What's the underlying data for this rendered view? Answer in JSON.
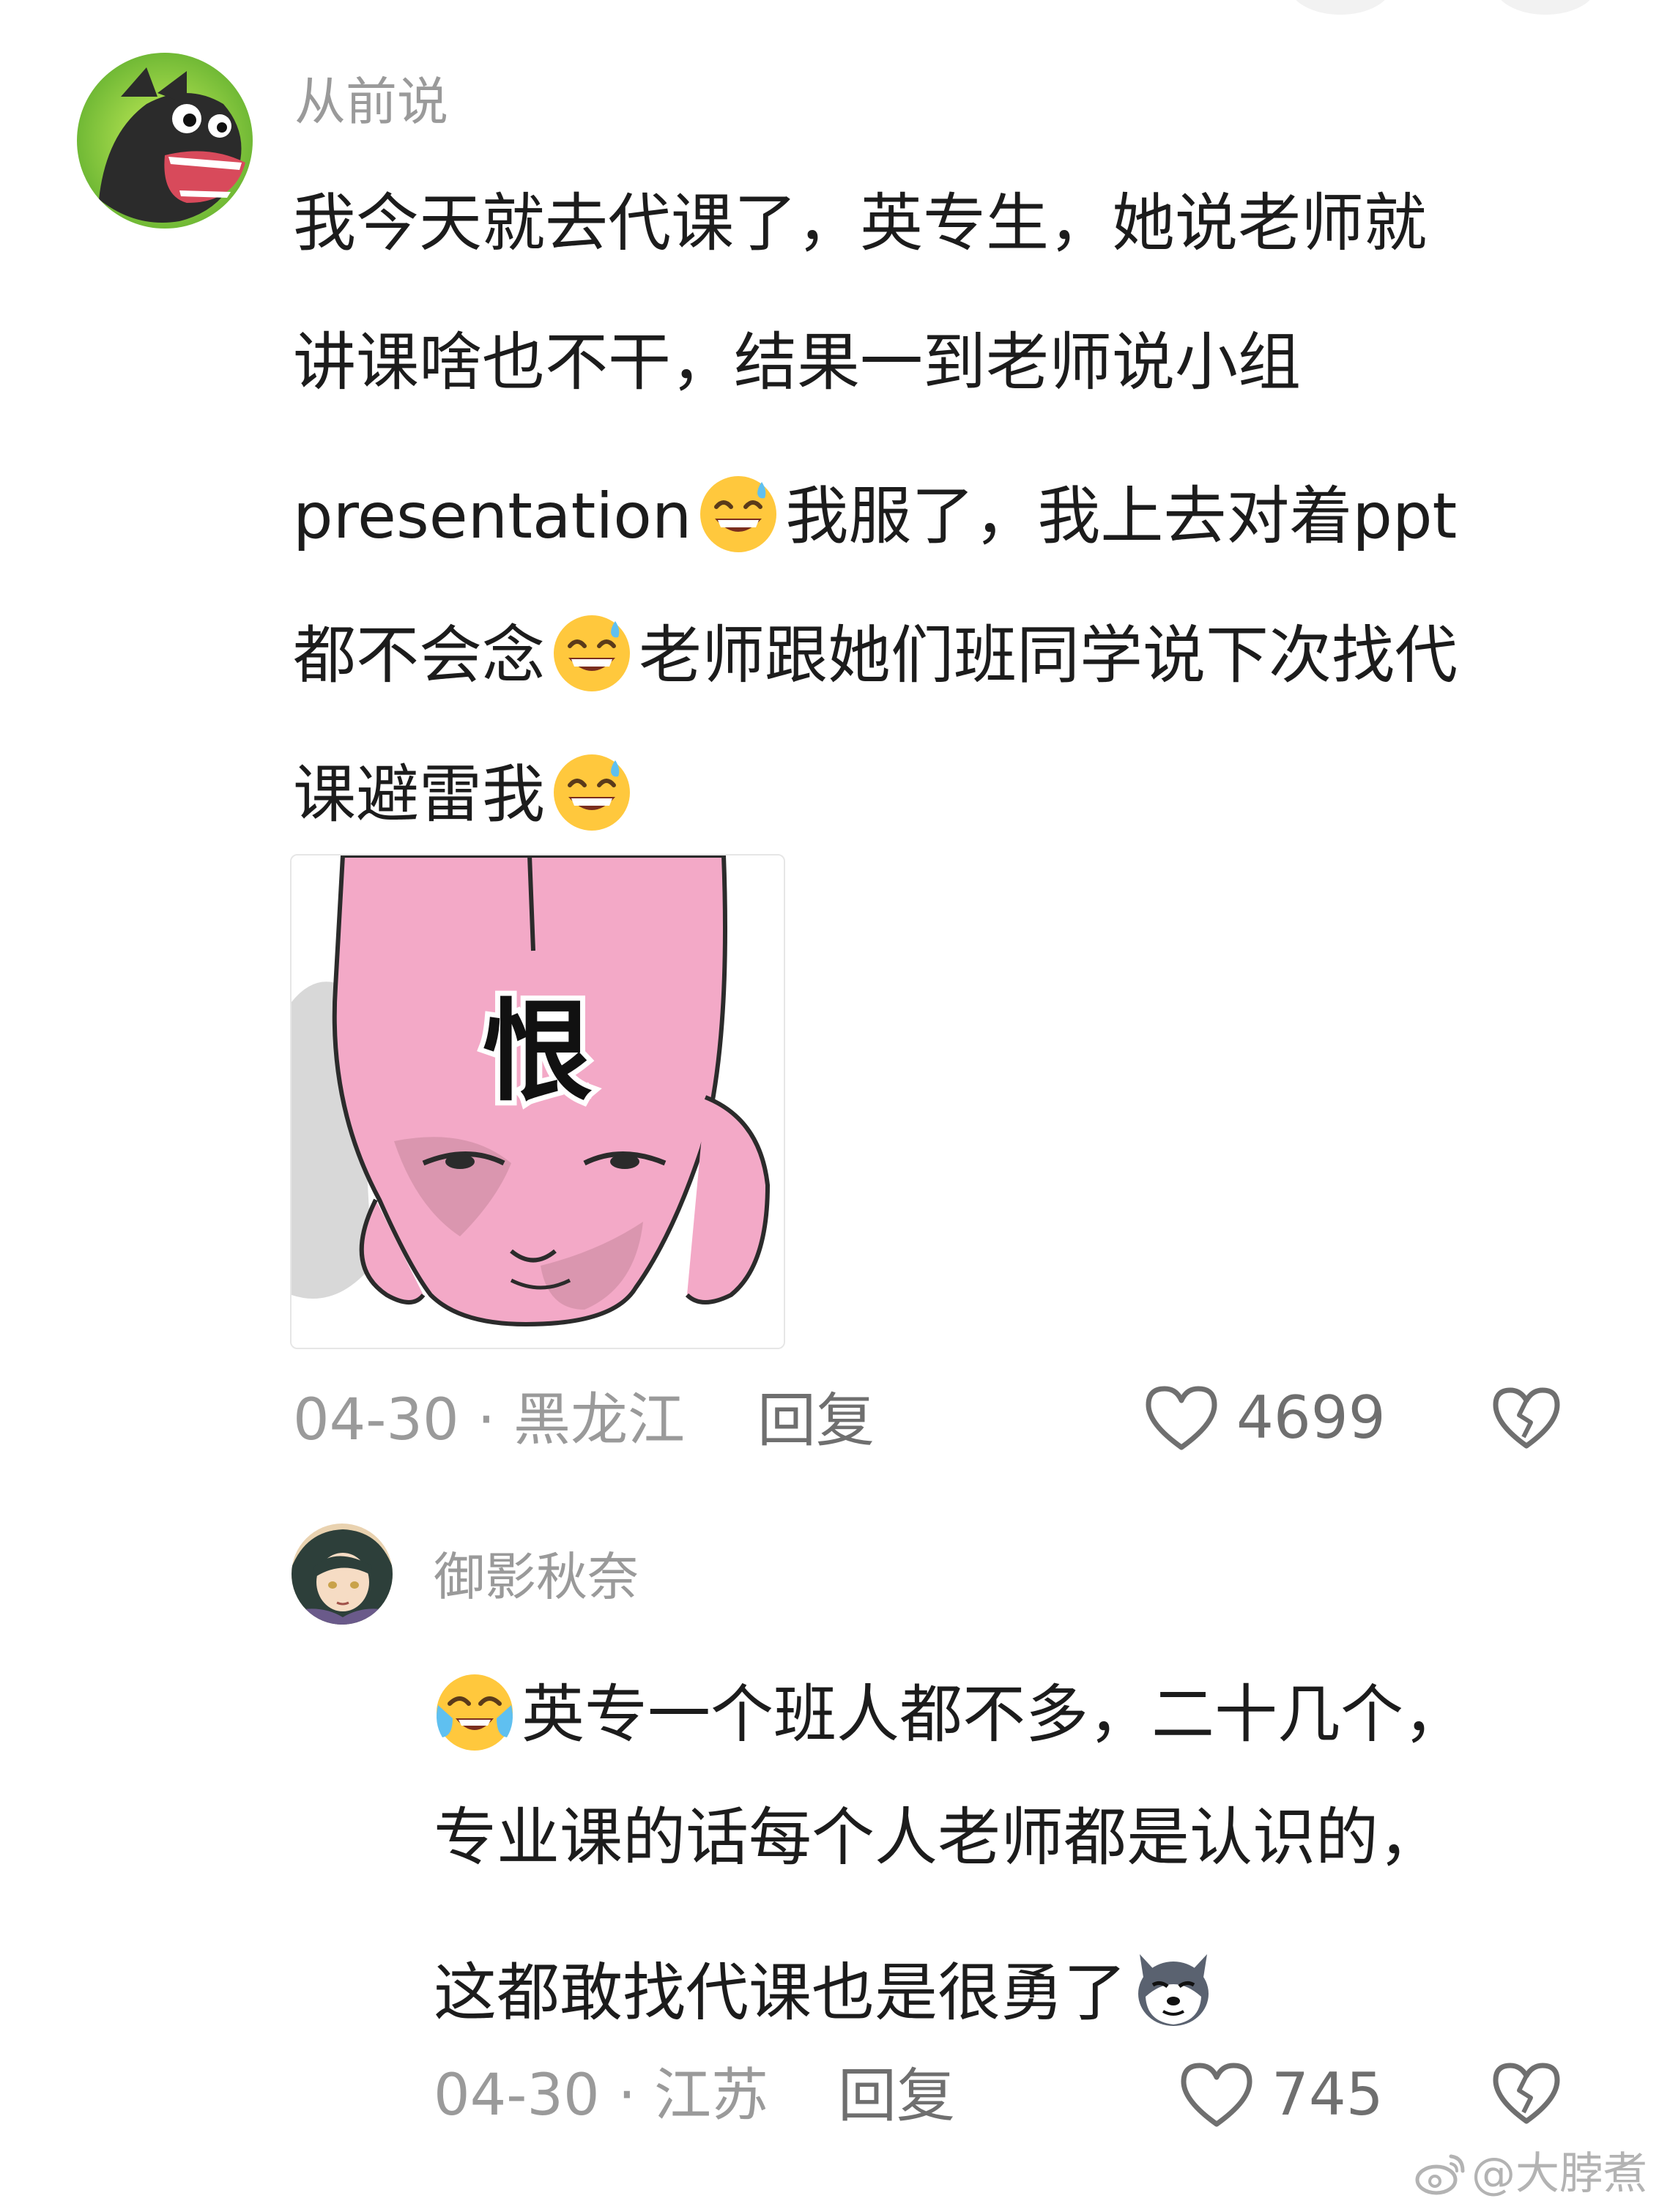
{
  "comments": [
    {
      "username": "从前说",
      "lines": [
        [
          "我今天就去代课了，英专生，她说老师就"
        ],
        [
          "讲课啥也不干，结果一到老师说小组"
        ],
        [
          "presentation",
          "我服了，我上去对着ppt"
        ],
        [
          "都不会念",
          "老师跟她们班同学说下次找代"
        ],
        [
          "课避雷我"
        ]
      ],
      "sticker_text": "恨",
      "date": "04-30",
      "separator": "·",
      "location": "黑龙江",
      "reply_label": "回复",
      "likes": "4699"
    },
    {
      "username": "御影秋奈",
      "lines": [
        [
          "英专一个班人都不多，二十几个，"
        ],
        [
          "专业课的话每个人老师都是认识的，"
        ],
        [
          "这都敢找代课也是很勇了"
        ]
      ],
      "date": "04-30",
      "separator": "·",
      "location": "江苏",
      "reply_label": "回复",
      "likes": "745"
    }
  ],
  "emoji_names": [
    "grin-sweat-emoji",
    "crying-laugh-emoji",
    "doge-husky-emoji"
  ],
  "watermark": "@大脖煮",
  "colors": {
    "text": "#1c1c1c",
    "meta": "#9a9a9a",
    "action": "#6f6f6f",
    "sticker_pink": "#f3a9c7"
  }
}
